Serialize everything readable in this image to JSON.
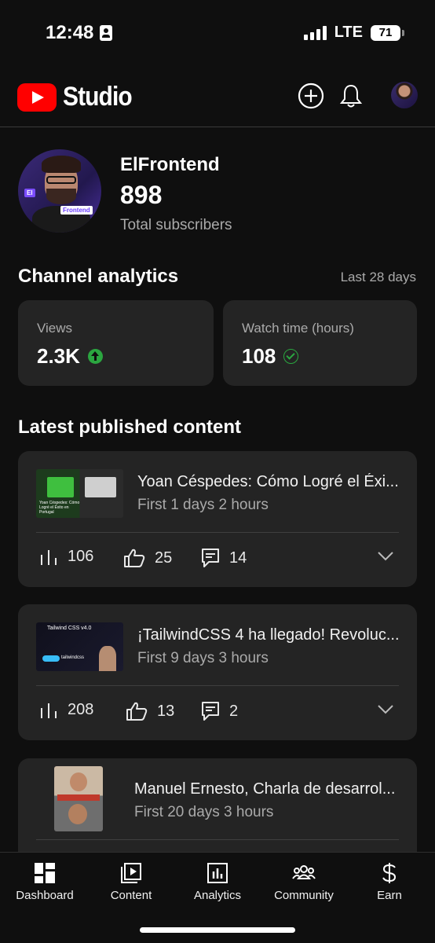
{
  "status_bar": {
    "time": "12:48",
    "network": "LTE",
    "battery": "71"
  },
  "header": {
    "logo_text": "Studio",
    "icons": [
      "create-icon",
      "bell-icon",
      "profile-avatar"
    ]
  },
  "channel": {
    "name": "ElFrontend",
    "subscribers": "898",
    "subscribers_label": "Total subscribers"
  },
  "analytics": {
    "title": "Channel analytics",
    "period": "Last 28 days",
    "views": {
      "label": "Views",
      "value": "2.3K",
      "trend_color": "#2ba640"
    },
    "watch_time": {
      "label": "Watch time (hours)",
      "value": "108",
      "status_color": "#2ba640"
    }
  },
  "latest": {
    "title": "Latest published content",
    "videos": [
      {
        "title": "Yoan Céspedes: Cómo Logré el Éxi...",
        "subtitle": "First 1 days 2 hours",
        "views": "106",
        "likes": "25",
        "comments": "14"
      },
      {
        "title": "¡TailwindCSS 4 ha llegado! Revoluc...",
        "subtitle": "First 9 days 3 hours",
        "views": "208",
        "likes": "13",
        "comments": "2",
        "thumb_text": "Tailwind CSS v4.0",
        "thumb_brand": "tailwindcss"
      },
      {
        "title": "Manuel Ernesto, Charla de desarrol...",
        "subtitle": "First 20 days 3 hours"
      }
    ]
  },
  "nav": {
    "items": [
      {
        "label": "Dashboard",
        "icon": "dashboard-icon"
      },
      {
        "label": "Content",
        "icon": "content-icon"
      },
      {
        "label": "Analytics",
        "icon": "analytics-icon"
      },
      {
        "label": "Community",
        "icon": "community-icon"
      },
      {
        "label": "Earn",
        "icon": "earn-icon"
      }
    ]
  },
  "colors": {
    "background": "#0f0f0f",
    "card": "#242424",
    "brand_red": "#ff0000",
    "positive_green": "#2ba640",
    "secondary_text": "#aaaaaa"
  }
}
